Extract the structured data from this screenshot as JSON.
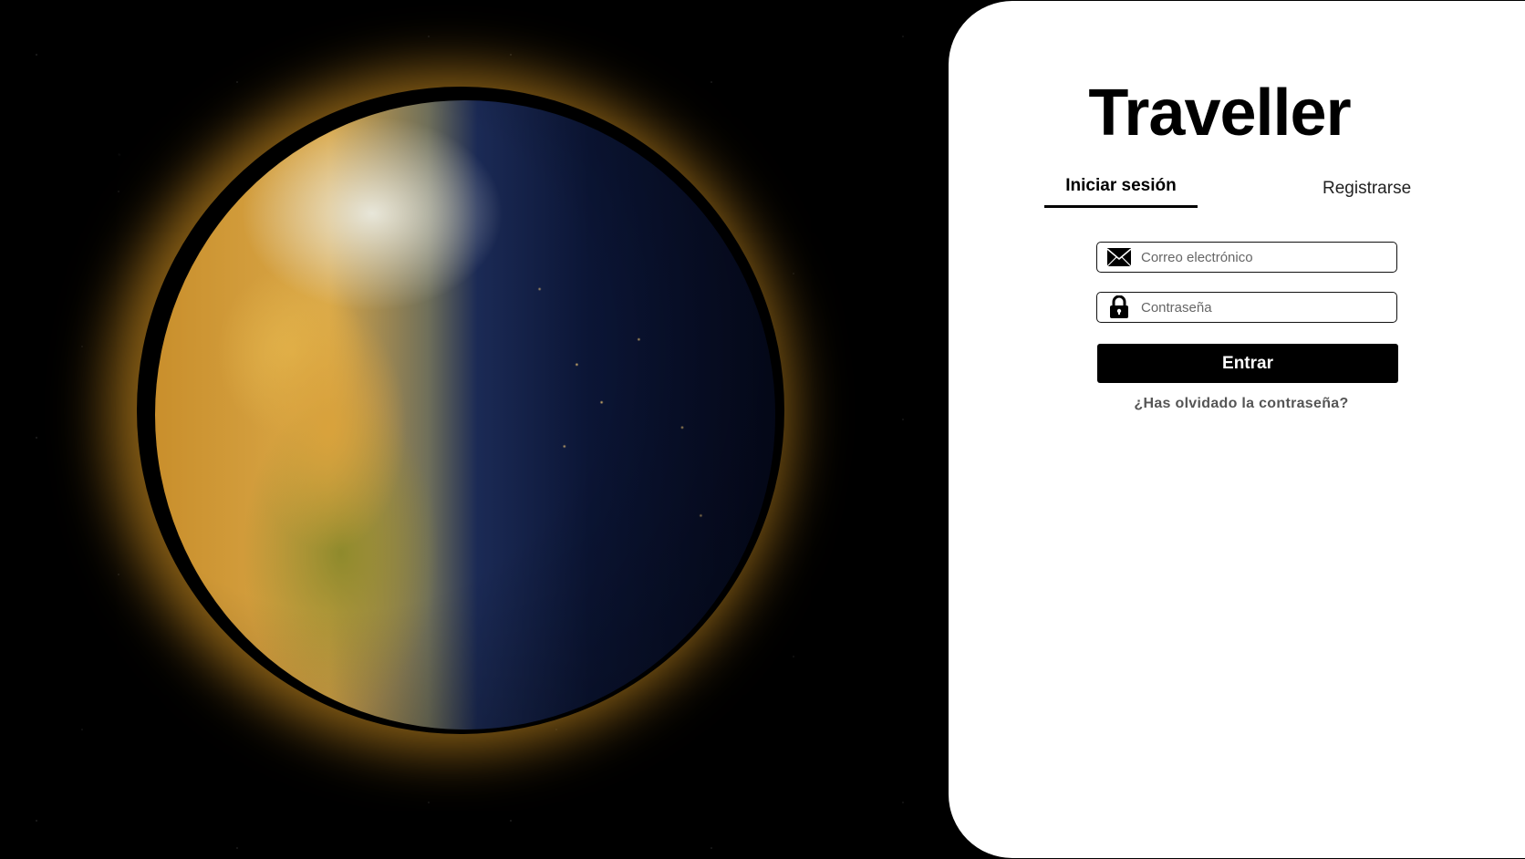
{
  "brand": {
    "title": "Traveller"
  },
  "tabs": {
    "login_label": "Iniciar sesión",
    "register_label": "Registrarse"
  },
  "form": {
    "email_placeholder": "Correo electrónico",
    "password_placeholder": "Contraseña",
    "submit_label": "Entrar",
    "forgot_label": "¿Has olvidado la contraseña?"
  },
  "icons": {
    "email": "envelope-icon",
    "password": "lock-icon"
  },
  "colors": {
    "primary": "#000000",
    "panel_background": "#ffffff",
    "muted_text": "#555555"
  }
}
